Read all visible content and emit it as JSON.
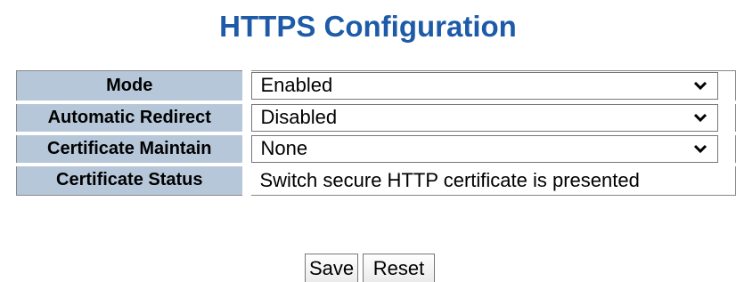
{
  "page": {
    "title": "HTTPS Configuration"
  },
  "rows": [
    {
      "label": "Mode",
      "control": "select",
      "value": "Enabled"
    },
    {
      "label": "Automatic Redirect",
      "control": "select",
      "value": "Disabled"
    },
    {
      "label": "Certificate Maintain",
      "control": "select",
      "value": "None"
    },
    {
      "label": "Certificate Status",
      "control": "text",
      "value": "Switch secure HTTP certificate is presented"
    }
  ],
  "buttons": {
    "save_label": "Save",
    "reset_label": "Reset"
  },
  "icons": {
    "select_arrow": "chevron-down-icon"
  },
  "colors": {
    "title": "#1d5ba8",
    "label_background": "#b6c7da",
    "table_border": "#888888"
  }
}
